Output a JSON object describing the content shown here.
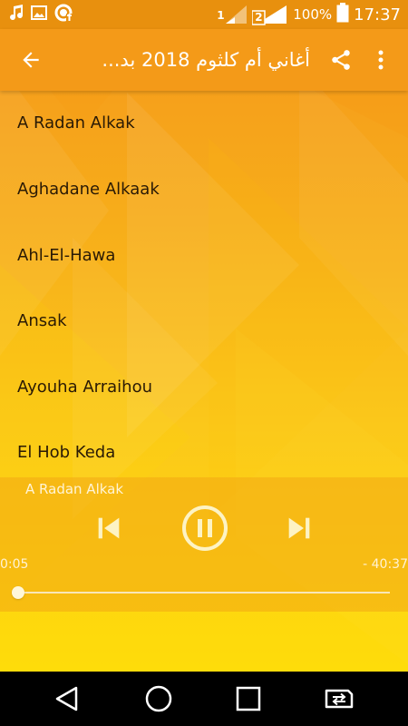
{
  "status_bar": {
    "battery": "100%",
    "time": "17:37",
    "sim1": "1",
    "sim2": "2",
    "notification_icons": [
      "music-note-icon",
      "image-icon",
      "data-saver-icon"
    ]
  },
  "toolbar": {
    "title": "أغاني أم كلثوم 2018 بد...",
    "back_icon": "arrow-back-icon",
    "share_icon": "share-icon",
    "more_icon": "more-vert-icon"
  },
  "songs": [
    "A Radan Alkak",
    "Aghadane Alkaak",
    "Ahl-El-Hawa",
    "Ansak",
    "Ayouha Arraihou",
    "El Hob Keda"
  ],
  "player": {
    "now_playing": "A Radan Alkak",
    "elapsed": "0:05",
    "remaining": "- 40:37",
    "progress": 0.002,
    "state": "playing"
  },
  "colors": {
    "toolbar": "#f49a18",
    "status_bar": "#e8900e",
    "background_top": "#f59a1c",
    "background_bottom": "#fedc0a",
    "player_controls": "#fdf3c4"
  }
}
